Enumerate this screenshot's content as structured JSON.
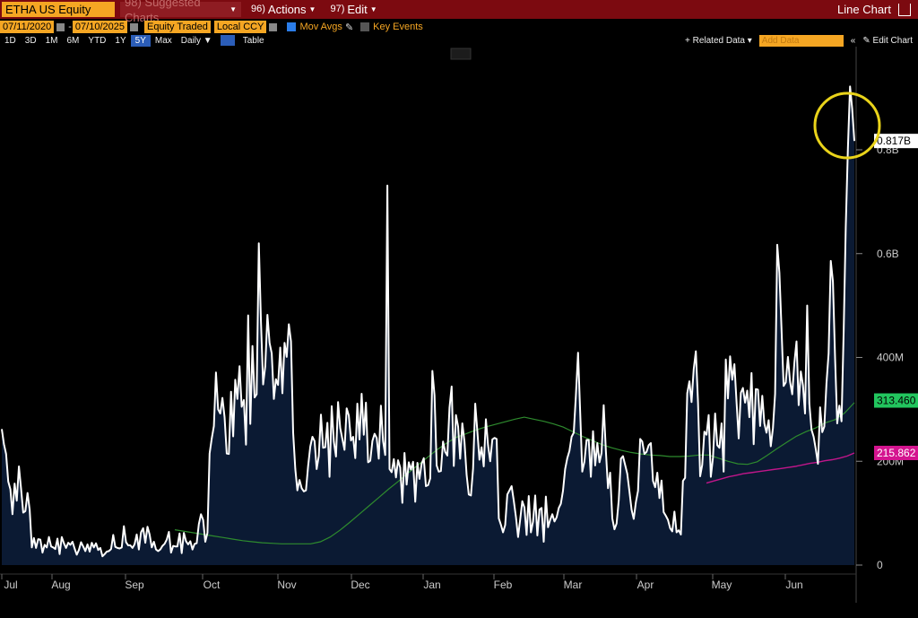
{
  "header": {
    "ticker": "ETHA US Equity",
    "suggested": "98) Suggested Charts",
    "actions_num": "96)",
    "actions": "Actions",
    "edit_num": "97)",
    "edit": "Edit",
    "chart_type": "Line Chart"
  },
  "controls": {
    "start_date": "07/11/2020",
    "end_date": "07/10/2025",
    "field": "Equity Traded",
    "currency": "Local CCY",
    "mov_avgs": "Mov Avgs",
    "key_events": "Key Events"
  },
  "toolbar": {
    "ranges": [
      "1D",
      "3D",
      "1M",
      "6M",
      "YTD",
      "1Y",
      "5Y",
      "Max"
    ],
    "active_range": "5Y",
    "interval": "Daily",
    "table": "Table",
    "related_data": "+ Related Data",
    "add_data": "Add Data",
    "edit_chart": "Edit Chart"
  },
  "colors": {
    "line": "#ffffff",
    "area": "#0b1a33",
    "ma_green": "#2e8b2e",
    "ma_magenta": "#c0168a",
    "highlight": "#e9d31a",
    "badge_green": "#22c55e",
    "badge_magenta": "#d4148f"
  },
  "chart_data": {
    "type": "line",
    "title": "",
    "ylim": [
      0,
      900000000
    ],
    "y_ticks": [
      {
        "value": 0,
        "label": "0"
      },
      {
        "value": 200000000,
        "label": "200M"
      },
      {
        "value": 400000000,
        "label": "400M"
      },
      {
        "value": 600000000,
        "label": "0.6B"
      },
      {
        "value": 800000000,
        "label": "0.8B"
      }
    ],
    "x_labels": [
      "Jul",
      "Aug",
      "Sep",
      "Oct",
      "Nov",
      "Dec",
      "Jan",
      "Feb",
      "Mar",
      "Apr",
      "May",
      "Jun"
    ],
    "series": [
      {
        "name": "",
        "role": "volume",
        "last_label": "0.817B",
        "values": [
          262,
          233,
          214,
          161,
          146,
          98,
          157,
          124,
          190,
          147,
          101,
          104,
          139,
          107,
          34,
          52,
          33,
          50,
          49,
          24,
          39,
          34,
          54,
          36,
          34,
          31,
          51,
          21,
          54,
          42,
          33,
          43,
          39,
          45,
          32,
          20,
          29,
          44,
          36,
          27,
          40,
          26,
          43,
          34,
          42,
          29,
          33,
          17,
          21,
          26,
          27,
          31,
          58,
          35,
          33,
          32,
          34,
          75,
          44,
          38,
          38,
          33,
          40,
          59,
          30,
          63,
          71,
          43,
          74,
          59,
          34,
          45,
          30,
          27,
          30,
          37,
          41,
          49,
          64,
          24,
          37,
          36,
          36,
          61,
          23,
          62,
          46,
          40,
          46,
          30,
          41,
          42,
          79,
          98,
          87,
          45,
          62,
          215,
          244,
          268,
          371,
          300,
          292,
          322,
          285,
          215,
          214,
          334,
          248,
          357,
          320,
          383,
          305,
          318,
          232,
          481,
          272,
          422,
          323,
          329,
          620,
          469,
          348,
          383,
          482,
          428,
          408,
          320,
          358,
          347,
          419,
          331,
          428,
          401,
          464,
          431,
          255,
          185,
          144,
          164,
          148,
          142,
          144,
          191,
          228,
          247,
          239,
          185,
          210,
          290,
          226,
          227,
          274,
          170,
          306,
          238,
          209,
          314,
          264,
          243,
          222,
          302,
          288,
          240,
          247,
          206,
          311,
          242,
          330,
          251,
          313,
          198,
          201,
          239,
          253,
          245,
          205,
          307,
          239,
          212,
          731,
          185,
          179,
          204,
          169,
          202,
          188,
          120,
          216,
          155,
          198,
          184,
          199,
          122,
          197,
          166,
          195,
          206,
          152,
          154,
          167,
          374,
          327,
          192,
          180,
          181,
          238,
          218,
          211,
          303,
          344,
          191,
          289,
          267,
          205,
          273,
          238,
          174,
          136,
          134,
          186,
          311,
          257,
          203,
          227,
          190,
          281,
          231,
          200,
          242,
          245,
          243,
          90,
          78,
          63,
          77,
          136,
          144,
          152,
          124,
          93,
          54,
          87,
          123,
          111,
          58,
          133,
          63,
          84,
          134,
          57,
          107,
          110,
          45,
          132,
          73,
          87,
          98,
          84,
          92,
          110,
          118,
          143,
          185,
          206,
          220,
          247,
          255,
          327,
          409,
          293,
          180,
          199,
          241,
          241,
          170,
          258,
          192,
          235,
          198,
          216,
          308,
          221,
          148,
          178,
          90,
          69,
          80,
          125,
          205,
          210,
          193,
          176,
          142,
          107,
          89,
          121,
          143,
          243,
          238,
          214,
          218,
          231,
          235,
          162,
          150,
          178,
          129,
          163,
          102,
          95,
          87,
          71,
          65,
          103,
          63,
          67,
          59,
          162,
          168,
          331,
          354,
          314,
          377,
          412,
          314,
          171,
          193,
          257,
          251,
          289,
          170,
          207,
          292,
          231,
          226,
          273,
          180,
          396,
          321,
          402,
          357,
          387,
          314,
          244,
          332,
          341,
          313,
          336,
          285,
          370,
          233,
          339,
          338,
          268,
          326,
          273,
          255,
          279,
          229,
          264,
          330,
          617,
          563,
          453,
          345,
          352,
          401,
          353,
          329,
          390,
          431,
          308,
          373,
          346,
          292,
          500,
          311,
          261,
          247,
          223,
          195,
          304,
          256,
          267,
          350,
          408,
          586,
          546,
          399,
          273,
          307,
          277,
          451,
          650,
          802,
          922,
          879,
          817
        ]
      },
      {
        "name": "",
        "role": "moving-average",
        "last_label": "313.460",
        "values": [
          68,
          65,
          62,
          59,
          56,
          53,
          50,
          47,
          45,
          43,
          42,
          41,
          41,
          41,
          41,
          45,
          54,
          67,
          82,
          98,
          114,
          130,
          146,
          161,
          177,
          192,
          207,
          222,
          235,
          246,
          253,
          260,
          266,
          271,
          276,
          281,
          285,
          281,
          277,
          272,
          266,
          257,
          248,
          240,
          232,
          226,
          221,
          217,
          214,
          212,
          211,
          209,
          209,
          210,
          212,
          212,
          206,
          200,
          195,
          194,
          199,
          211,
          224,
          236,
          248,
          257,
          264,
          274,
          280,
          293,
          313
        ]
      },
      {
        "name": "",
        "role": "moving-average-long",
        "last_label": "215.862",
        "values": [
          158,
          162,
          166,
          170,
          173,
          176,
          178,
          180,
          182,
          184,
          186,
          188,
          190,
          193,
          196,
          198,
          201,
          203,
          206,
          210,
          216
        ]
      }
    ],
    "annotations": [
      {
        "type": "circle",
        "target": "peak near end of Jun"
      }
    ]
  }
}
